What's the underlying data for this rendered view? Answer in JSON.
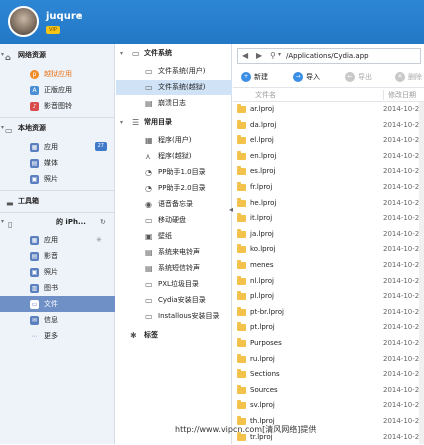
{
  "user": {
    "name": "juqure",
    "caret": "▾",
    "vip": "VIP"
  },
  "sidebar": {
    "sections": [
      {
        "label": "网络资源"
      },
      {
        "label": "本地资源"
      },
      {
        "label": "工具箱"
      }
    ],
    "items": [
      {
        "label": "越狱应用"
      },
      {
        "label": "正版应用"
      },
      {
        "label": "影音图铃"
      },
      {
        "label": "应用",
        "badge": "27"
      },
      {
        "label": "媒体"
      },
      {
        "label": "照片"
      }
    ],
    "device": {
      "label": "的 iPh..."
    },
    "device_items": [
      {
        "label": "应用"
      },
      {
        "label": "影音"
      },
      {
        "label": "照片"
      },
      {
        "label": "图书"
      },
      {
        "label": "文件"
      },
      {
        "label": "信息"
      },
      {
        "label": "更多"
      }
    ]
  },
  "tree": {
    "fs_label": "文件系统",
    "fs_items": [
      {
        "label": "文件系统(用户)"
      },
      {
        "label": "文件系统(越狱)"
      },
      {
        "label": "崩溃日志"
      }
    ],
    "common_label": "常用目录",
    "common_items": [
      {
        "label": "程序(用户)"
      },
      {
        "label": "程序(越狱)"
      },
      {
        "label": "PP助手1.0目录"
      },
      {
        "label": "PP助手2.0目录"
      },
      {
        "label": "语音备忘录"
      },
      {
        "label": "移动硬盘"
      },
      {
        "label": "壁纸"
      },
      {
        "label": "系统来电铃声"
      },
      {
        "label": "系统短信铃声"
      },
      {
        "label": "PXL垃圾目录"
      },
      {
        "label": "Cydia安装目录"
      },
      {
        "label": "Installous安装目录"
      }
    ],
    "tags_label": "标签"
  },
  "address": {
    "path": "/Applications/Cydia.app"
  },
  "toolbar": {
    "new": "新建",
    "import": "导入",
    "export": "导出",
    "delete": "删除"
  },
  "columns": {
    "name": "文件名",
    "date": "修改日期"
  },
  "files": [
    {
      "name": "ar.lproj",
      "date": "2014-10-26"
    },
    {
      "name": "da.lproj",
      "date": "2014-10-26"
    },
    {
      "name": "el.lproj",
      "date": "2014-10-26"
    },
    {
      "name": "en.lproj",
      "date": "2014-10-26"
    },
    {
      "name": "es.lproj",
      "date": "2014-10-26"
    },
    {
      "name": "fr.lproj",
      "date": "2014-10-26"
    },
    {
      "name": "he.lproj",
      "date": "2014-10-26"
    },
    {
      "name": "it.lproj",
      "date": "2014-10-26"
    },
    {
      "name": "ja.lproj",
      "date": "2014-10-26"
    },
    {
      "name": "ko.lproj",
      "date": "2014-10-26"
    },
    {
      "name": "menes",
      "date": "2014-10-23"
    },
    {
      "name": "nl.lproj",
      "date": "2014-10-26"
    },
    {
      "name": "pl.lproj",
      "date": "2014-10-26"
    },
    {
      "name": "pt-br.lproj",
      "date": "2014-10-26"
    },
    {
      "name": "pt.lproj",
      "date": "2014-10-26"
    },
    {
      "name": "Purposes",
      "date": "2014-10-23"
    },
    {
      "name": "ru.lproj",
      "date": "2014-10-26"
    },
    {
      "name": "Sections",
      "date": "2014-10-23"
    },
    {
      "name": "Sources",
      "date": "2014-10-23"
    },
    {
      "name": "sv.lproj",
      "date": "2014-10-26"
    },
    {
      "name": "th.lproj",
      "date": "2014-10-26"
    },
    {
      "name": "tr.lproj",
      "date": "2014-10-26"
    }
  ],
  "watermark": "http://www.vipcn.com[清风网络]提供"
}
